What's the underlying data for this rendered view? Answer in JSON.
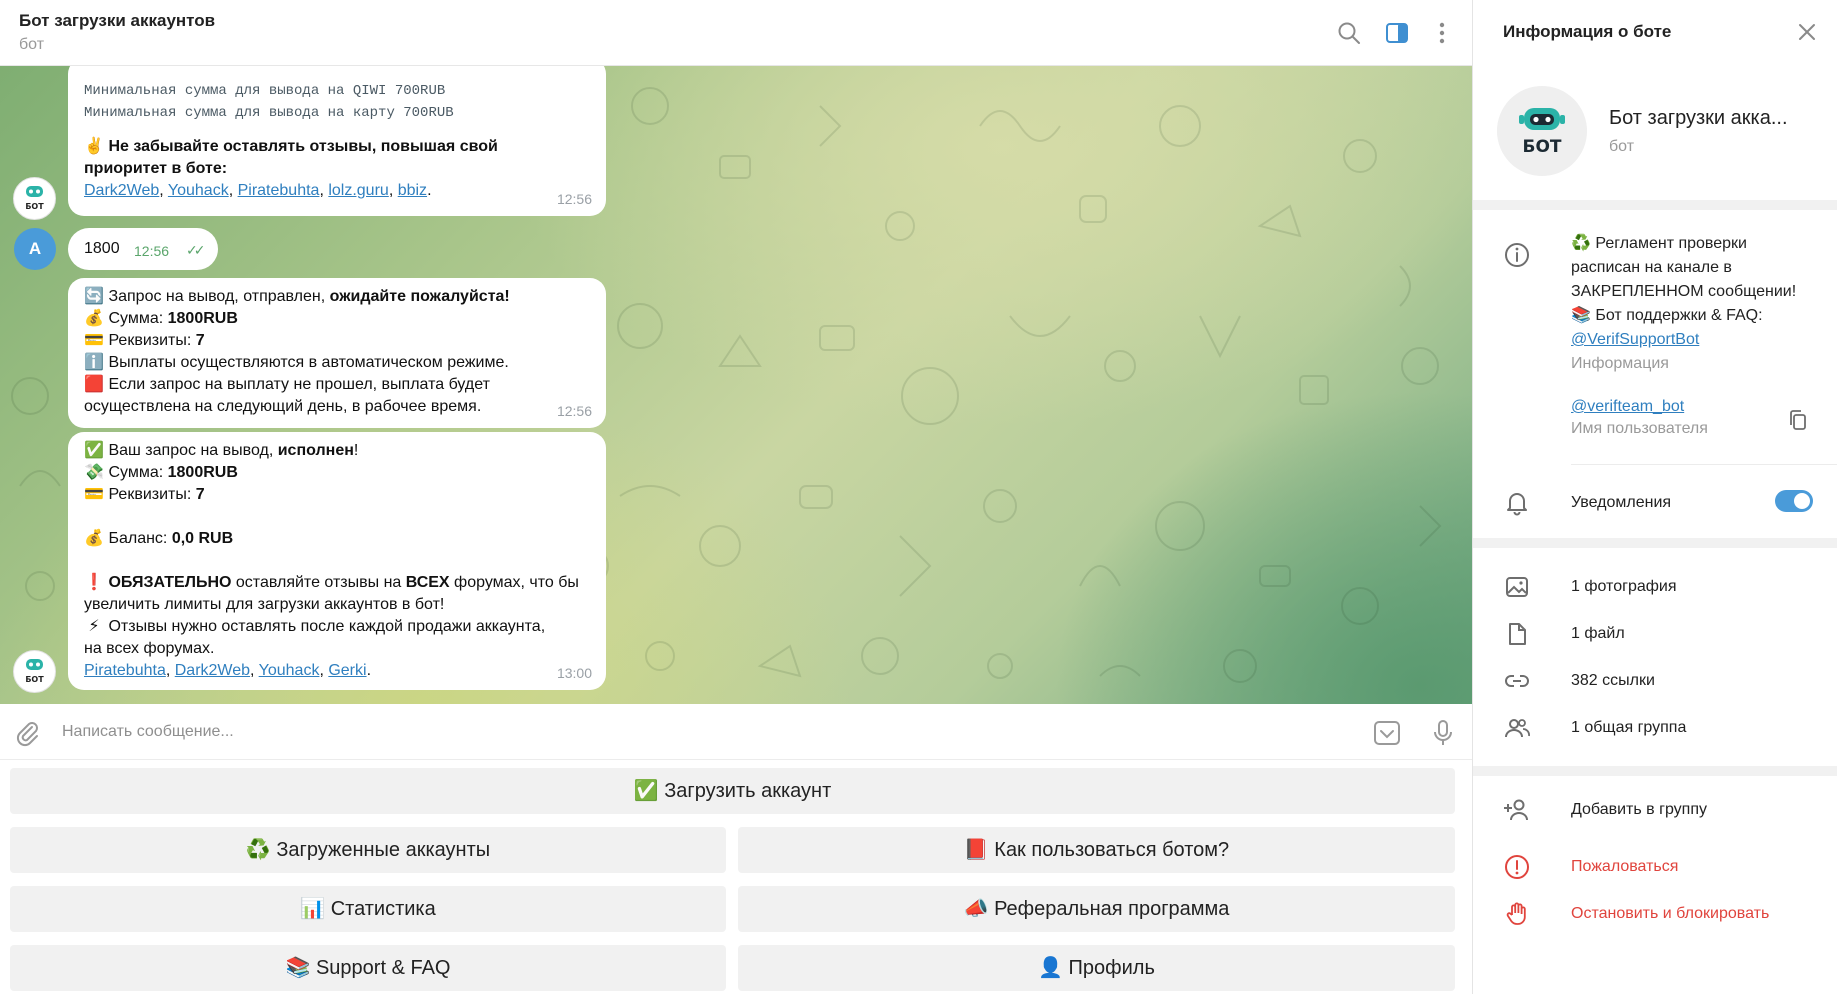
{
  "header": {
    "title": "Бот загрузки аккаунтов",
    "subtitle": "бот"
  },
  "messages": {
    "m1": {
      "mono1": "Минимальная сумма для вывода на QIWI 700RUB",
      "mono2": "Минимальная сумма для вывода на карту 700RUB",
      "emoji": "✌️",
      "text1": "Не забывайте оставлять отзывы, повышая свой",
      "text2": "приоритет в боте:",
      "links": [
        "Dark2Web",
        "Youhack",
        "Piratebuhta",
        "lolz.guru",
        "bbiz"
      ],
      "sep": ", ",
      "end": ".",
      "time": "12:56"
    },
    "m2": {
      "avatar_letter": "A",
      "text": "1800",
      "time": "12:56",
      "check": "✓✓"
    },
    "m3": {
      "l1_emoji": "🔄",
      "l1_a": "Запрос на вывод,  отправлен, ",
      "l1_b": "ожидайте пожалуйста!",
      "l2_emoji": "💰",
      "l2_a": "Сумма: ",
      "l2_b": "1800RUB",
      "l3_emoji": "💳",
      "l3_a": "Реквизиты: ",
      "l3_b": "7",
      "l4_emoji": "ℹ️",
      "l4": "Выплаты осуществляются в автоматическом режиме.",
      "l5_emoji": "🟥",
      "l5": "Если запрос на выплату не прошел, выплата будет",
      "l6": "осуществлена на следующий день, в рабочее время.",
      "time": "12:56"
    },
    "m4": {
      "l1_emoji": "✅",
      "l1_a": "Ваш запрос на вывод, ",
      "l1_b": "исполнен",
      "l1_c": "!",
      "l2_emoji": "💸",
      "l2_a": "Сумма: ",
      "l2_b": "1800RUB",
      "l3_emoji": "💳",
      "l3_a": "Реквизиты: ",
      "l3_b": "7",
      "l4_emoji": "💰",
      "l4_a": "Баланс: ",
      "l4_b": "0,0 RUB",
      "l5_emoji": "❗",
      "l5_a": "ОБЯЗАТЕЛЬНО",
      "l5_b": " оставляйте отзывы на ",
      "l5_c": "ВСЕХ",
      "l5_d": " форумах, что бы",
      "l6": "увеличить лимиты для загрузки аккаунтов в бот!",
      "l7_emoji": "⚡",
      "l7": "Отзывы нужно оставлять после каждой продажи аккаунта,",
      "l8": "на всех форумах.",
      "links": [
        "Piratebuhta",
        "Dark2Web",
        "Youhack",
        "Gerki"
      ],
      "sep": ", ",
      "end": ".",
      "time": "13:00"
    },
    "bot_avatar_text": "БОТ"
  },
  "composer": {
    "placeholder": "Написать сообщение..."
  },
  "keyboard": {
    "upload": "✅ Загрузить аккаунт",
    "uploaded": "♻️ Загруженные аккаунты",
    "howto": "📕 Как пользоваться ботом?",
    "stats": "📊 Статистика",
    "referral": "📣 Реферальная программа",
    "support": "📚 Support & FAQ",
    "profile": "👤 Профиль"
  },
  "side": {
    "title": "Информация о боте",
    "name": "Бот загрузки акка...",
    "sub": "бот",
    "avatar_text": "БОТ",
    "about": {
      "l1": "♻️ Регламент проверки",
      "l2": "расписан на канале в",
      "l3": "ЗАКРЕПЛЕННОМ сообщении!",
      "l4": "📚 Бот поддержки & FAQ:",
      "link": "@VerifSupportBot",
      "caption": "Информация"
    },
    "username": {
      "value": "@verifteam_bot",
      "caption": "Имя пользователя"
    },
    "notifications": "Уведомления",
    "media": {
      "photos": "1 фотография",
      "files": "1 файл",
      "links": "382 ссылки",
      "groups": "1 общая группа"
    },
    "actions": {
      "add": "Добавить в группу",
      "report": "Пожаловаться",
      "block": "Остановить и блокировать"
    }
  },
  "colors": {
    "accent": "#4a9bd9",
    "link": "#2f7fbf",
    "danger": "#e0443d",
    "bubble": "#ffffff",
    "button": "#f1f1f1"
  }
}
